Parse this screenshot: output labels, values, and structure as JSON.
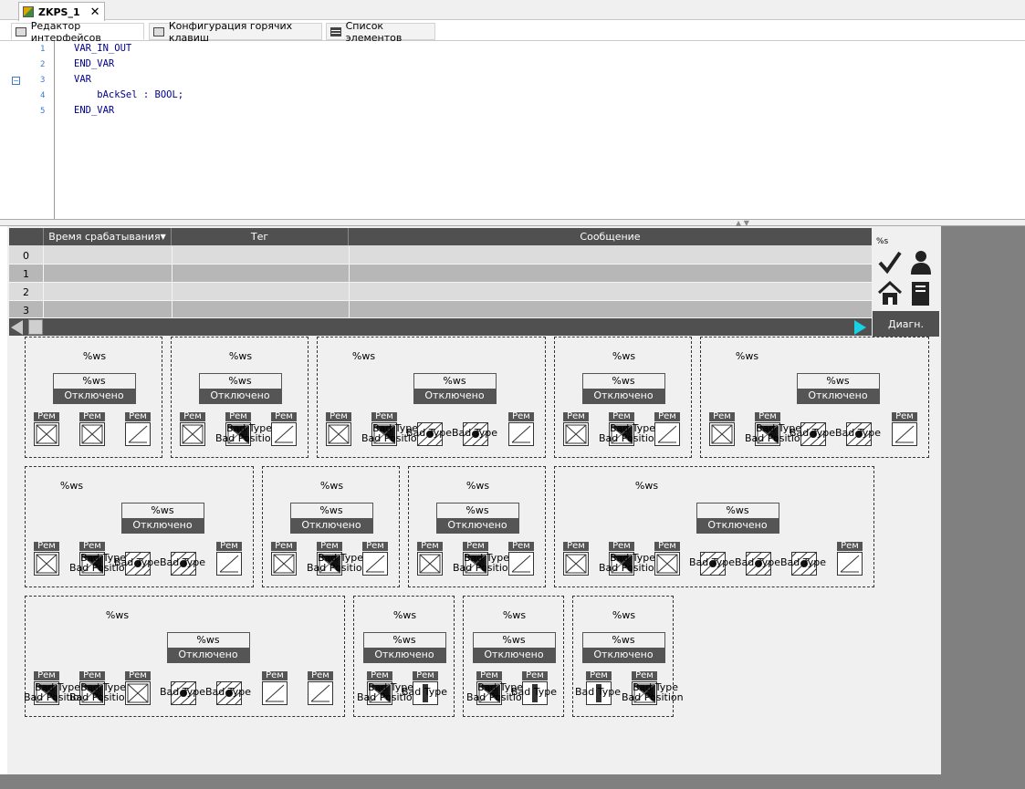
{
  "doc_tab": {
    "title": "ZKPS_1",
    "close": "✕"
  },
  "sub_tabs": [
    {
      "label": "Редактор интерфейсов"
    },
    {
      "label": "Конфигурация горячих клавиш"
    },
    {
      "label": "Список элементов"
    }
  ],
  "code_lines": [
    {
      "n": "1",
      "text": "VAR_IN_OUT"
    },
    {
      "n": "2",
      "text": "END_VAR"
    },
    {
      "n": "3",
      "text": "VAR"
    },
    {
      "n": "4",
      "text": "    bAckSel : BOOL;"
    },
    {
      "n": "5",
      "text": "END_VAR"
    }
  ],
  "alarm_table": {
    "columns": [
      "Время срабатывания",
      "Тег",
      "Сообщение"
    ],
    "rows": [
      "0",
      "1",
      "2",
      "3"
    ]
  },
  "side_panel": {
    "label": "%s",
    "diag_label": "Диагн."
  },
  "labels": {
    "ws": "%ws",
    "status": "Отключено",
    "rem": "Рем",
    "bad_type": "Bad Type",
    "bad_position": "Bad Position"
  },
  "colors": {
    "header": "#505050",
    "row_alt": "#b7b7b7",
    "accent": "#19d2e6"
  }
}
